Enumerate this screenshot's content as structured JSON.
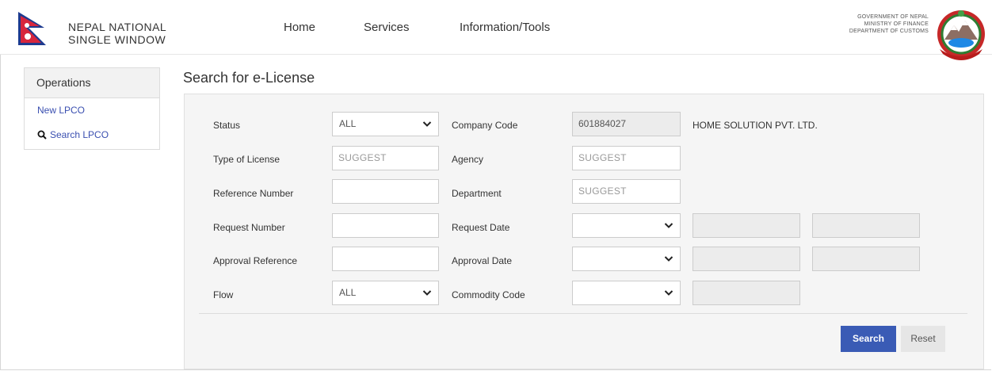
{
  "header": {
    "brand_line1": "NEPAL NATIONAL",
    "brand_line2": "SINGLE WINDOW",
    "nav": [
      "Home",
      "Services",
      "Information/Tools"
    ],
    "gov_line1": "GOVERNMENT OF NEPAL",
    "gov_line2": "MINISTRY OF FINANCE",
    "gov_line3": "DEPARTMENT OF CUSTOMS"
  },
  "sidebar": {
    "title": "Operations",
    "items": [
      "New LPCO",
      "Search LPCO"
    ]
  },
  "main": {
    "title": "Search for e-License"
  },
  "form": {
    "status_label": "Status",
    "status_value": "ALL",
    "type_label": "Type of License",
    "type_placeholder": "SUGGEST",
    "reference_label": "Reference Number",
    "request_number_label": "Request Number",
    "approval_reference_label": "Approval Reference",
    "flow_label": "Flow",
    "flow_value": "ALL",
    "company_code_label": "Company Code",
    "company_code_value": "601884027",
    "company_name": "HOME SOLUTION PVT. LTD.",
    "agency_label": "Agency",
    "agency_placeholder": "SUGGEST",
    "department_label": "Department",
    "department_placeholder": "SUGGEST",
    "request_date_label": "Request Date",
    "approval_date_label": "Approval Date",
    "commodity_code_label": "Commodity Code",
    "search_label": "Search",
    "reset_label": "Reset"
  },
  "colors": {
    "accent": "#3a5bb5",
    "link": "#3a4fb0",
    "panel_bg": "#f5f5f5"
  },
  "icons": [
    "nepal-flag-icon",
    "government-emblem-icon",
    "search-icon",
    "chevron-down-icon"
  ]
}
